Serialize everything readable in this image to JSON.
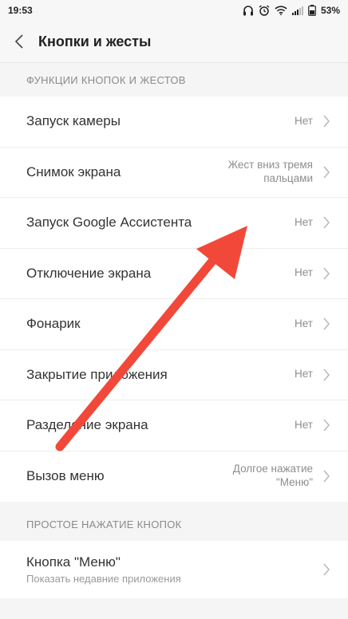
{
  "status": {
    "time": "19:53",
    "battery": "53%"
  },
  "header": {
    "title": "Кнопки и жесты"
  },
  "sections": [
    {
      "title": "ФУНКЦИИ КНОПОК И ЖЕСТОВ",
      "items": [
        {
          "label": "Запуск камеры",
          "value": "Нет"
        },
        {
          "label": "Снимок экрана",
          "value_line1": "Жест вниз тремя",
          "value_line2": "пальцами"
        },
        {
          "label": "Запуск Google Ассистента",
          "value": "Нет"
        },
        {
          "label": "Отключение экрана",
          "value": "Нет"
        },
        {
          "label": "Фонарик",
          "value": "Нет"
        },
        {
          "label": "Закрытие приложения",
          "value": "Нет"
        },
        {
          "label": "Разделение экрана",
          "value": "Нет"
        },
        {
          "label": "Вызов меню",
          "value_line1": "Долгое нажатие",
          "value_line2": "\"Меню\""
        }
      ]
    },
    {
      "title": "ПРОСТОЕ НАЖАТИЕ КНОПОК",
      "items": [
        {
          "label": "Кнопка \"Меню\"",
          "subtitle": "Показать недавние приложения"
        }
      ]
    }
  ],
  "colors": {
    "annotation_arrow": "#f2483a"
  },
  "icons": {
    "back": "chevron-left-icon",
    "chevron": "chevron-right-icon",
    "headphones": "headphones-icon",
    "alarm": "alarm-icon",
    "wifi": "wifi-icon",
    "signal": "signal-icon",
    "battery": "battery-icon"
  }
}
